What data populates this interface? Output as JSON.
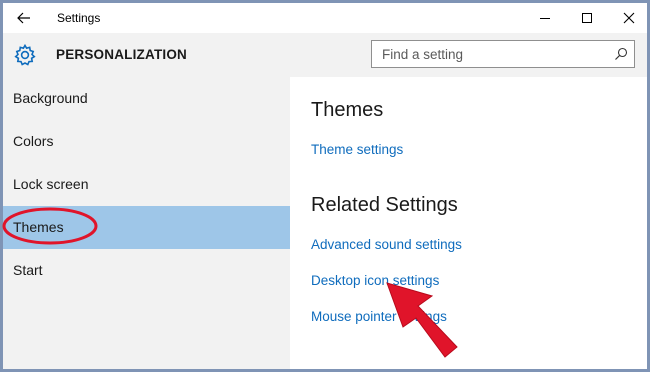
{
  "window": {
    "title": "Settings",
    "colors": {
      "accent": "#0f6cbd",
      "selected": "#9ec6e8",
      "annotation": "#e0142a"
    }
  },
  "header": {
    "section_title": "PERSONALIZATION",
    "search": {
      "placeholder": "Find a setting"
    }
  },
  "sidebar": {
    "items": [
      {
        "label": "Background",
        "selected": false
      },
      {
        "label": "Colors",
        "selected": false
      },
      {
        "label": "Lock screen",
        "selected": false
      },
      {
        "label": "Themes",
        "selected": true
      },
      {
        "label": "Start",
        "selected": false
      }
    ]
  },
  "content": {
    "themes_heading": "Themes",
    "theme_settings_link": "Theme settings",
    "related_heading": "Related Settings",
    "related_links": [
      "Advanced sound settings",
      "Desktop icon settings",
      "Mouse pointer settings"
    ]
  }
}
